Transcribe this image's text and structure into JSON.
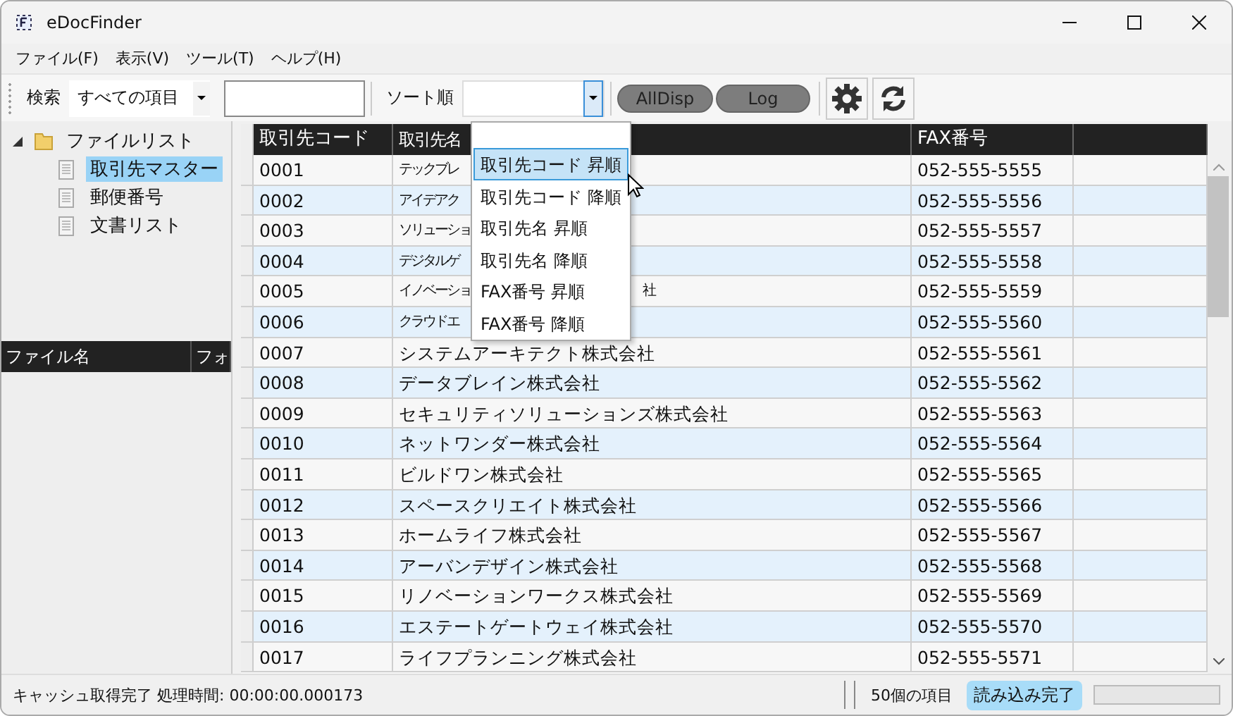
{
  "window": {
    "title": "eDocFinder"
  },
  "menu": [
    "ファイル(F)",
    "表示(V)",
    "ツール(T)",
    "ヘルプ(H)"
  ],
  "toolbar": {
    "search_label": "検索",
    "search_scope": "すべての項目",
    "sort_label": "ソート順",
    "buttons": [
      "AllDisp",
      "Log"
    ]
  },
  "tree": {
    "label": "ファイルリスト",
    "expanded": true,
    "children": [
      {
        "label": "取引先マスター",
        "selected": true
      },
      {
        "label": "郵便番号",
        "selected": false
      },
      {
        "label": "文書リスト",
        "selected": false
      }
    ]
  },
  "file_list": {
    "columns": [
      "ファイル名",
      "フォ"
    ]
  },
  "table": {
    "columns": [
      "取引先コード",
      "取引先名",
      "FAX番号"
    ],
    "rows": [
      {
        "code": "0001",
        "name": "テックブレ",
        "fax": "052-555-5555"
      },
      {
        "code": "0002",
        "name": "アイデアク",
        "fax": "052-555-5556"
      },
      {
        "code": "0003",
        "name": "ソリューショ",
        "fax": "052-555-5557"
      },
      {
        "code": "0004",
        "name": "デジタルゲ",
        "fax": "052-555-5558"
      },
      {
        "code": "0005",
        "name": "イノベーショ",
        "name_tail": "社",
        "fax": "052-555-5559"
      },
      {
        "code": "0006",
        "name": "クラウドエ",
        "fax": "052-555-5560"
      },
      {
        "code": "0007",
        "name": "システムアーキテクト株式会社",
        "fax": "052-555-5561"
      },
      {
        "code": "0008",
        "name": "データブレイン株式会社",
        "fax": "052-555-5562"
      },
      {
        "code": "0009",
        "name": "セキュリティソリューションズ株式会社",
        "fax": "052-555-5563"
      },
      {
        "code": "0010",
        "name": "ネットワンダー株式会社",
        "fax": "052-555-5564"
      },
      {
        "code": "0011",
        "name": "ビルドワン株式会社",
        "fax": "052-555-5565"
      },
      {
        "code": "0012",
        "name": "スペースクリエイト株式会社",
        "fax": "052-555-5566"
      },
      {
        "code": "0013",
        "name": "ホームライフ株式会社",
        "fax": "052-555-5567"
      },
      {
        "code": "0014",
        "name": "アーバンデザイン株式会社",
        "fax": "052-555-5568"
      },
      {
        "code": "0015",
        "name": "リノベーションワークス株式会社",
        "fax": "052-555-5569"
      },
      {
        "code": "0016",
        "name": "エステートゲートウェイ株式会社",
        "fax": "052-555-5570"
      },
      {
        "code": "0017",
        "name": "ライフプランニング株式会社",
        "fax": "052-555-5571"
      }
    ]
  },
  "sort_dropdown": {
    "options": [
      {
        "label": "取引先コード 昇順",
        "selected": true
      },
      {
        "label": "取引先コード 降順",
        "selected": false
      },
      {
        "label": "取引先名 昇順",
        "selected": false
      },
      {
        "label": "取引先名 降順",
        "selected": false
      },
      {
        "label": "FAX番号 昇順",
        "selected": false
      },
      {
        "label": "FAX番号 降順",
        "selected": false
      }
    ]
  },
  "status_bar": {
    "message": "キャッシュ取得完了 処理時間: 00:00:00.000173",
    "count": "50個の項目",
    "state": "読み込み完了",
    "progress": {
      "level": 0
    }
  }
}
